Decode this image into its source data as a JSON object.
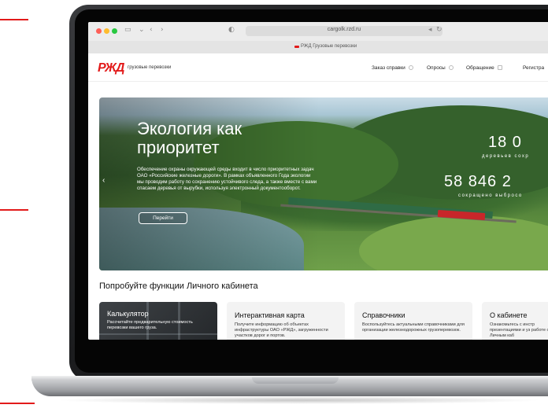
{
  "browser": {
    "url": "cargolk.rzd.ru",
    "tab_title": "РЖД Грузовые перевозки"
  },
  "site": {
    "logo": "РЖД",
    "logo_subtitle": "грузовые перевозки",
    "nav": [
      {
        "label": "Заказ справки"
      },
      {
        "label": "Опросы"
      },
      {
        "label": "Обращение"
      },
      {
        "label": "Регистра"
      }
    ]
  },
  "hero": {
    "title": "Экология как приоритет",
    "text": "Обеспечение охраны окружающей среды входит в число приоритетных задач ОАО «Российские железные дороги». В рамках объявленного Года экологии мы проводим работу по сохранению устойчивого следа, а также вместе с вами спасаем деревья от вырубки, используя электронный документооборот.",
    "button": "Перейти",
    "stat1_value": "18 0",
    "stat1_label": "деревьев сохр",
    "stat2_value": "58 846 2",
    "stat2_label": "сокращено выбросо"
  },
  "features": {
    "title": "Попробуйте функции Личного кабинета",
    "cards": [
      {
        "title": "Калькулятор",
        "text": "Рассчитайте предварительную стоимость перевозки вашего груза."
      },
      {
        "title": "Интерактивная карта",
        "text": "Получите информацию об объектах инфраструктуры ОАО «РЖД», загруженности участков дорог и портов."
      },
      {
        "title": "Справочники",
        "text": "Воспользуйтесь актуальными справочниками для организации железнодорожных грузоперевозок."
      },
      {
        "title": "О кабинете",
        "text": "Ознакомьтесь с инстр презентациями и уз работе с Личным каб"
      }
    ]
  },
  "colors": {
    "brand_red": "#e21a1a"
  }
}
